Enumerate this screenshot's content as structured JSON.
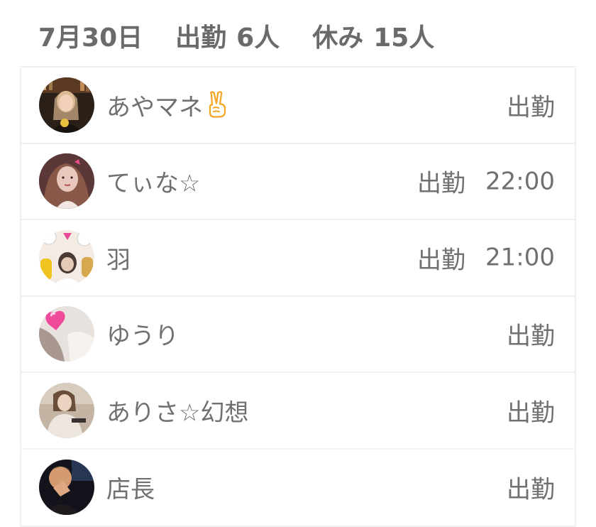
{
  "header": {
    "date": "7月30日",
    "working_label": "出勤",
    "working_count": "6人",
    "off_label": "休み",
    "off_count": "15人"
  },
  "staff": [
    {
      "name": "あやマネ",
      "emoji": "victory-hand",
      "status": "出勤",
      "time": ""
    },
    {
      "name": "てぃな☆",
      "status": "出勤",
      "time": "22:00"
    },
    {
      "name": "羽",
      "status": "出勤",
      "time": "21:00"
    },
    {
      "name": "ゆうり",
      "status": "出勤",
      "time": ""
    },
    {
      "name": "ありさ☆幻想",
      "status": "出勤",
      "time": ""
    },
    {
      "name": "店長",
      "status": "出勤",
      "time": ""
    }
  ],
  "colors": {
    "text": "#707070",
    "divider": "#f0f0f0",
    "emoji": "#f4a623"
  }
}
